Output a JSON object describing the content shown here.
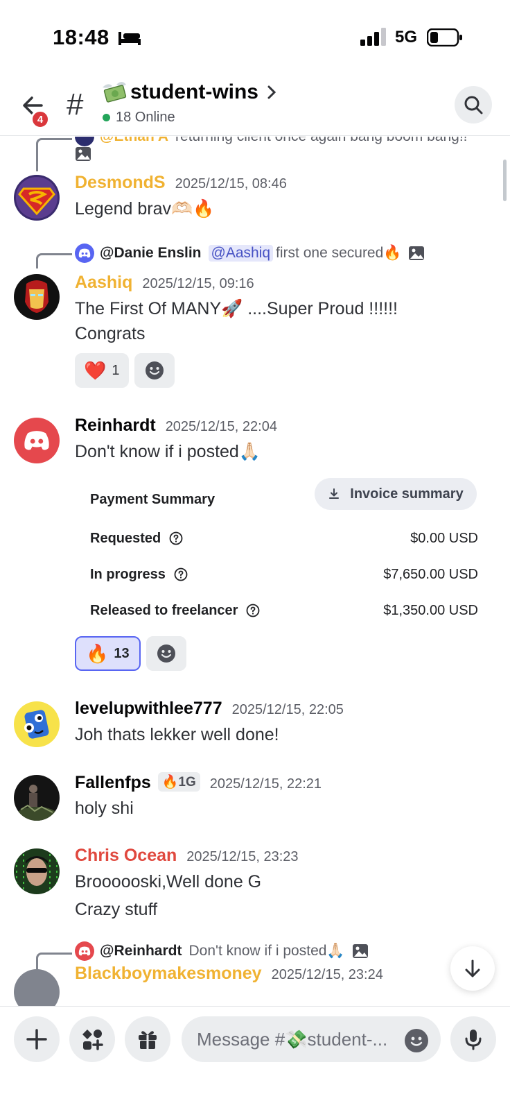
{
  "status_bar": {
    "time": "18:48",
    "network": "5G"
  },
  "header": {
    "notif_count": "4",
    "hash": "#",
    "channel_name": "student-wins",
    "online": "18 Online"
  },
  "messages": [
    {
      "id": "m0",
      "reply_name": "@Ethan A",
      "reply_text": "returning client once again bang boom bang!!"
    },
    {
      "id": "m1",
      "username": "DesmondS",
      "username_color": "#f0b232",
      "timestamp": "2025/12/15, 08:46",
      "text": "Legend brav🫶🏻🔥"
    },
    {
      "id": "m2",
      "reply_name": "@Danie Enslin",
      "reply_mention": "@Aashiq",
      "reply_text": "first one secured🔥",
      "username": "Aashiq",
      "username_color": "#f0b232",
      "timestamp": "2025/12/15, 09:16",
      "text_line1": "The First Of MANY🚀 ....Super Proud !!!!!!",
      "text_line2": "Congrats",
      "reaction_emoji": "❤️",
      "reaction_count": "1"
    },
    {
      "id": "m3",
      "username": "Reinhardt",
      "username_color": "#060607",
      "timestamp": "2025/12/15, 22:04",
      "text": "Don't know if i posted🙏🏻",
      "payment": {
        "title": "Payment Summary",
        "invoice_label": "Invoice summary",
        "rows": [
          {
            "label": "Requested",
            "value": "$0.00 USD"
          },
          {
            "label": "In progress",
            "value": "$7,650.00 USD"
          },
          {
            "label": "Released to freelancer",
            "value": "$1,350.00 USD"
          }
        ]
      },
      "reaction_emoji": "🔥",
      "reaction_count": "13"
    },
    {
      "id": "m4",
      "username": "levelupwithlee777",
      "username_color": "#060607",
      "timestamp": "2025/12/15, 22:05",
      "text": "Joh thats lekker well done!"
    },
    {
      "id": "m5",
      "username": "Fallenfps",
      "username_color": "#060607",
      "role_badge": "🔥1G",
      "timestamp": "2025/12/15, 22:21",
      "text": "holy shi"
    },
    {
      "id": "m6",
      "username": "Chris Ocean",
      "username_color": "#e0483e",
      "timestamp": "2025/12/15, 23:23",
      "text_line1": "Broooooski,Well done G",
      "text_line2": "Crazy stuff"
    },
    {
      "id": "m7",
      "reply_name": "@Reinhardt",
      "reply_text": "Don't know if i posted🙏🏻",
      "username": "Blackboymakesmoney",
      "username_color": "#f0b232",
      "timestamp": "2025/12/15, 23:24"
    }
  ],
  "composer": {
    "placeholder": "Message #💸student-..."
  },
  "colors": {
    "accent": "#5865f2",
    "online": "#23a55a",
    "badge": "#da373c"
  }
}
